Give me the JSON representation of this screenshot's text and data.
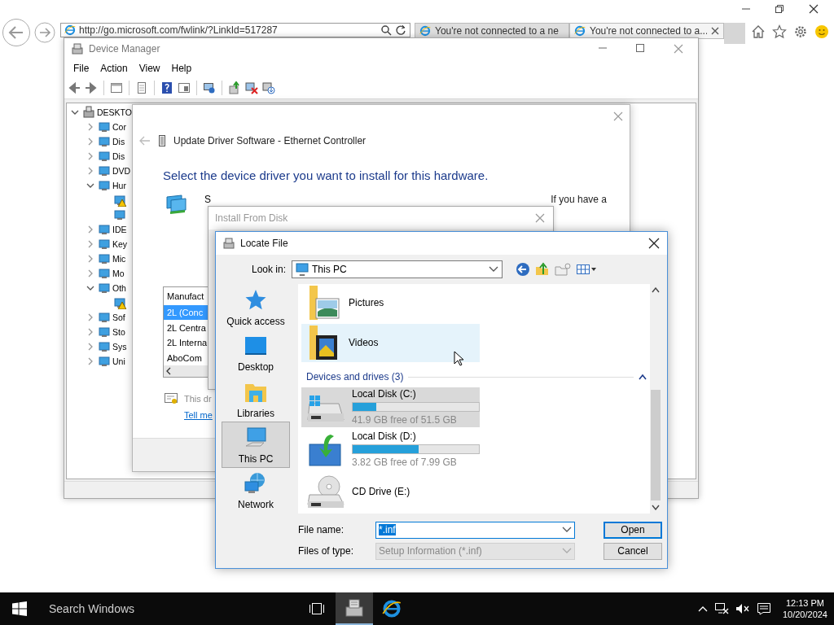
{
  "browser": {
    "address": "http://go.microsoft.com/fwlink/?LinkId=517287",
    "tabs": [
      {
        "label": "You're not connected to a ne",
        "selected": false
      },
      {
        "label": "You're not connected to a...",
        "selected": true
      }
    ]
  },
  "device_manager": {
    "title": "Device Manager",
    "menu": [
      "File",
      "Action",
      "View",
      "Help"
    ],
    "tree": [
      {
        "label": "DESKTO",
        "expanded": true,
        "children": [
          {
            "label": "Cor",
            "expanded": false
          },
          {
            "label": "Dis",
            "expanded": false
          },
          {
            "label": "Dis",
            "expanded": false
          },
          {
            "label": "DVD",
            "expanded": false
          },
          {
            "label": "Hur",
            "expanded": true,
            "children": [
              {
                "warning": true
              },
              {
                "warning": false
              }
            ]
          },
          {
            "label": "IDE",
            "expanded": false
          },
          {
            "label": "Key",
            "expanded": false
          },
          {
            "label": "Mic",
            "expanded": false
          },
          {
            "label": "Mo",
            "expanded": false
          },
          {
            "label": "Oth",
            "expanded": true,
            "children": [
              {
                "warning": true
              }
            ]
          },
          {
            "label": "Sof",
            "expanded": false
          },
          {
            "label": "Sto",
            "expanded": false
          },
          {
            "label": "Sys",
            "expanded": false
          },
          {
            "label": "Uni",
            "expanded": false
          }
        ]
      }
    ]
  },
  "update_driver": {
    "title": "Update Driver Software - Ethernet Controller",
    "heading": "Select the device driver you want to install for this hardware.",
    "instruction_start": "S",
    "instruction_end": "If you have a",
    "list": {
      "header": "Manufact",
      "rows": [
        {
          "label": "2L (Conc",
          "selected": true
        },
        {
          "label": "2L Centra",
          "selected": false
        },
        {
          "label": "2L Interna",
          "selected": false
        },
        {
          "label": "AboCom",
          "selected": false
        }
      ]
    },
    "signed_note": "This dr",
    "link": "Tell me"
  },
  "install_from_disk": {
    "title": "Install From Disk"
  },
  "locate_file": {
    "title": "Locate File",
    "look_in_label": "Look in:",
    "look_in": "This PC",
    "places": [
      {
        "label": "Quick access",
        "kind": "star",
        "selected": false
      },
      {
        "label": "Desktop",
        "kind": "desktop",
        "selected": false
      },
      {
        "label": "Libraries",
        "kind": "libraries",
        "selected": false
      },
      {
        "label": "This PC",
        "kind": "pc",
        "selected": true
      },
      {
        "label": "Network",
        "kind": "network",
        "selected": false
      }
    ],
    "folders": [
      {
        "label": "Pictures",
        "kind": "pictures",
        "hovered": false
      },
      {
        "label": "Videos",
        "kind": "videos",
        "hovered": true
      }
    ],
    "group": {
      "label": "Devices and drives (3)",
      "expanded": true
    },
    "drives": [
      {
        "label": "Local Disk (C:)",
        "kind": "system",
        "level": 0.19,
        "free": "41.9 GB free of 51.5 GB",
        "selected": true
      },
      {
        "label": "Local Disk (D:)",
        "kind": "setup",
        "level": 0.52,
        "free": "3.82 GB free of 7.99 GB",
        "selected": false
      },
      {
        "label": "CD Drive (E:)",
        "kind": "cd",
        "selected": false
      }
    ],
    "file_name_label": "File name:",
    "file_name": "*.inf",
    "file_type_label": "Files of type:",
    "file_type": "Setup Information (*.inf)",
    "file_type_disabled": true,
    "buttons": [
      "Open",
      "Cancel"
    ]
  },
  "taskbar": {
    "search_placeholder": "Search Windows",
    "apps": [
      {
        "kind": "device-manager",
        "active": true
      },
      {
        "kind": "browser",
        "active": false
      }
    ],
    "time": "12:13 PM",
    "date": "10/20/2024"
  }
}
